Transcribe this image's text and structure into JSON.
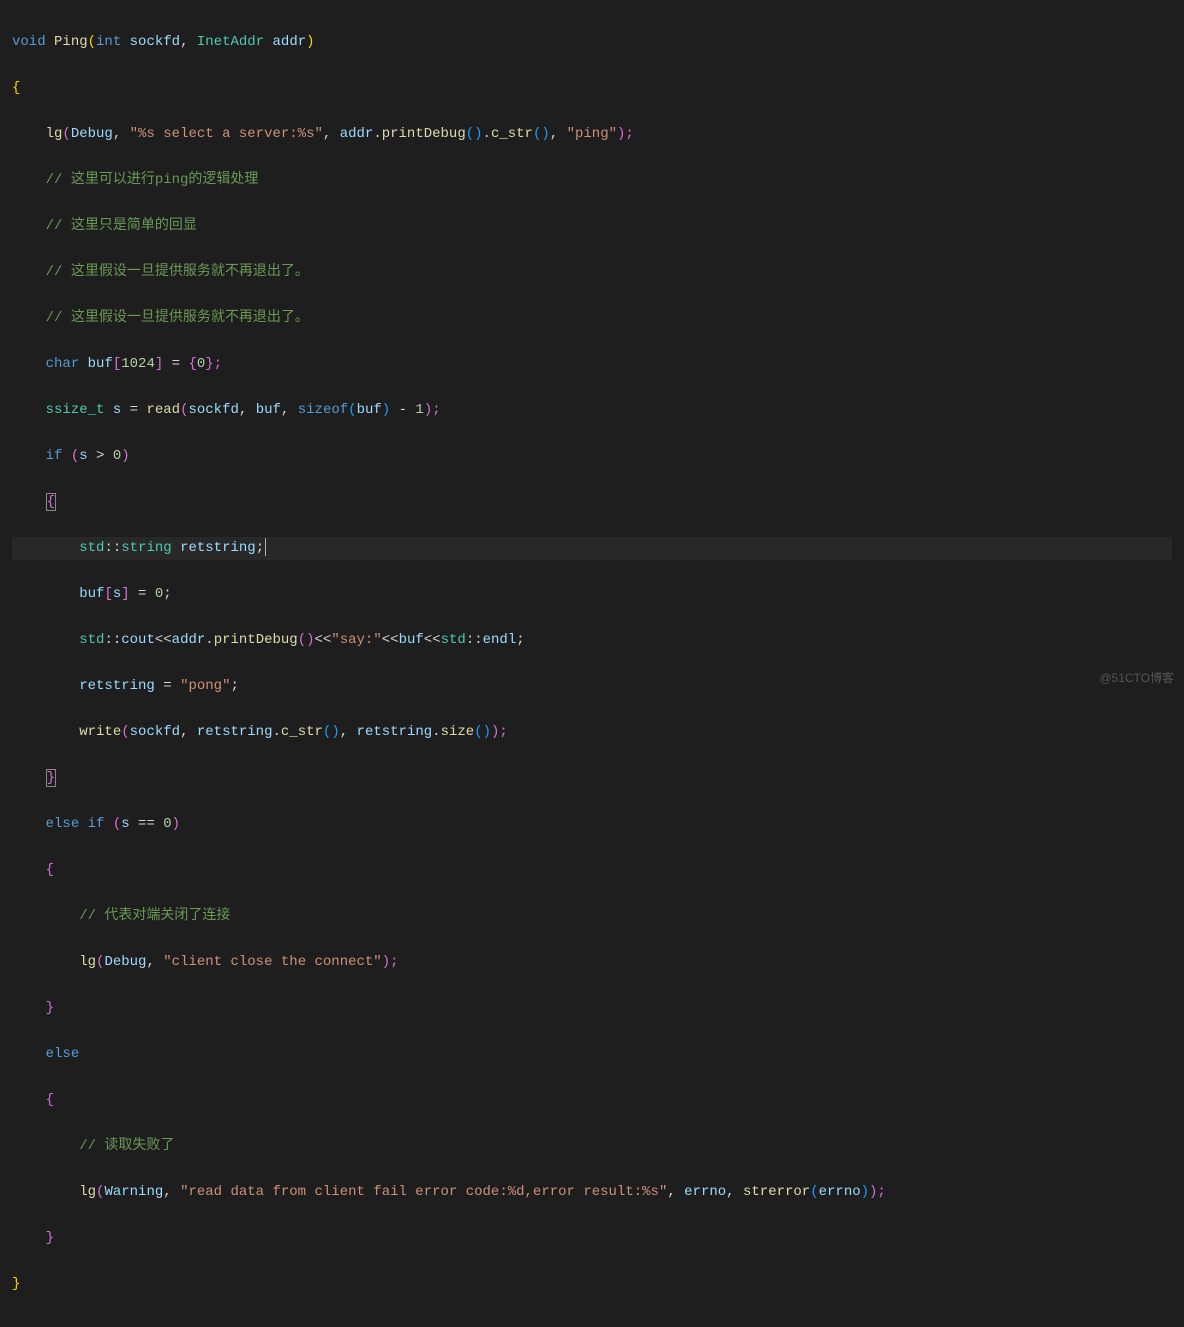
{
  "code": {
    "line1": {
      "kw_void": "void",
      "func": "Ping",
      "p1": "(",
      "kw_int": "int",
      "var1": "sockfd",
      "comma": ", ",
      "type": "InetAddr",
      "var2": "addr",
      "p2": ")"
    },
    "line2": {
      "brace": "{"
    },
    "line3": {
      "func": "lg",
      "p1": "(",
      "var1": "Debug",
      "c1": ", ",
      "str1": "\"%s select a server:%s\"",
      "c2": ", ",
      "var2": "addr",
      "dot1": ".",
      "func2": "printDebug",
      "p2": "()",
      "dot2": ".",
      "func3": "c_str",
      "p3": "()",
      "c3": ", ",
      "str2": "\"ping\"",
      "p4": ");"
    },
    "line4": {
      "com": "// 这里可以进行ping的逻辑处理"
    },
    "line5": {
      "com": "// 这里只是简单的回显"
    },
    "line6": {
      "com": "// 这里假设一旦提供服务就不再退出了。"
    },
    "line7": {
      "com": "// 这里假设一旦提供服务就不再退出了。"
    },
    "line8": {
      "kw": "char",
      "var": "buf",
      "b1": "[",
      "num1": "1024",
      "b2": "]",
      "eq": " = ",
      "b3": "{",
      "num2": "0",
      "b4": "};"
    },
    "line9": {
      "type": "ssize_t",
      "var1": "s",
      "eq": " = ",
      "func": "read",
      "p1": "(",
      "var2": "sockfd",
      "c1": ", ",
      "var3": "buf",
      "c2": ", ",
      "kw": "sizeof",
      "p2": "(",
      "var4": "buf",
      "p3": ")",
      "minus": " - ",
      "num": "1",
      "p4": ");"
    },
    "line10": {
      "kw": "if",
      "p1": " (",
      "var": "s",
      "op": " > ",
      "num": "0",
      "p2": ")"
    },
    "line11": {
      "brace": "{"
    },
    "line12": {
      "ns": "std",
      "dc": "::",
      "type": "string",
      "var": "retstring",
      "semi": ";"
    },
    "line13": {
      "var1": "buf",
      "b1": "[",
      "var2": "s",
      "b2": "]",
      "eq": " = ",
      "num": "0",
      "semi": ";"
    },
    "line14": {
      "ns1": "std",
      "dc1": "::",
      "var1": "cout",
      "op1": "<<",
      "var2": "addr",
      "dot": ".",
      "func": "printDebug",
      "p1": "()",
      "op2": "<<",
      "str": "\"say:\"",
      "op3": "<<",
      "var3": "buf",
      "op4": "<<",
      "ns2": "std",
      "dc2": "::",
      "var4": "endl",
      "semi": ";"
    },
    "line15": {
      "var": "retstring",
      "eq": " = ",
      "str": "\"pong\"",
      "semi": ";"
    },
    "line16": {
      "func": "write",
      "p1": "(",
      "var1": "sockfd",
      "c1": ", ",
      "var2": "retstring",
      "dot1": ".",
      "func2": "c_str",
      "p2": "()",
      "c2": ", ",
      "var3": "retstring",
      "dot2": ".",
      "func3": "size",
      "p3": "()",
      "p4": ");"
    },
    "line17": {
      "brace": "}"
    },
    "line18": {
      "kw1": "else",
      "kw2": "if",
      "p1": " (",
      "var": "s",
      "op": " == ",
      "num": "0",
      "p2": ")"
    },
    "line19": {
      "brace": "{"
    },
    "line20": {
      "com": "// 代表对端关闭了连接"
    },
    "line21": {
      "func": "lg",
      "p1": "(",
      "var": "Debug",
      "c": ", ",
      "str": "\"client close the connect\"",
      "p2": ");"
    },
    "line22": {
      "brace": "}"
    },
    "line23": {
      "kw": "else"
    },
    "line24": {
      "brace": "{"
    },
    "line25": {
      "com": "// 读取失败了"
    },
    "line26": {
      "func": "lg",
      "p1": "(",
      "var1": "Warning",
      "c1": ", ",
      "str": "\"read data from client fail error code:%d,error result:%s\"",
      "c2": ", ",
      "var2": "errno",
      "c3": ", ",
      "func2": "strerror",
      "p2": "(",
      "var3": "errno",
      "p3": ")",
      "p4": ");"
    },
    "line27": {
      "brace": "}"
    },
    "line28": {
      "brace": "}"
    }
  },
  "watermark": "@51CTO博客"
}
